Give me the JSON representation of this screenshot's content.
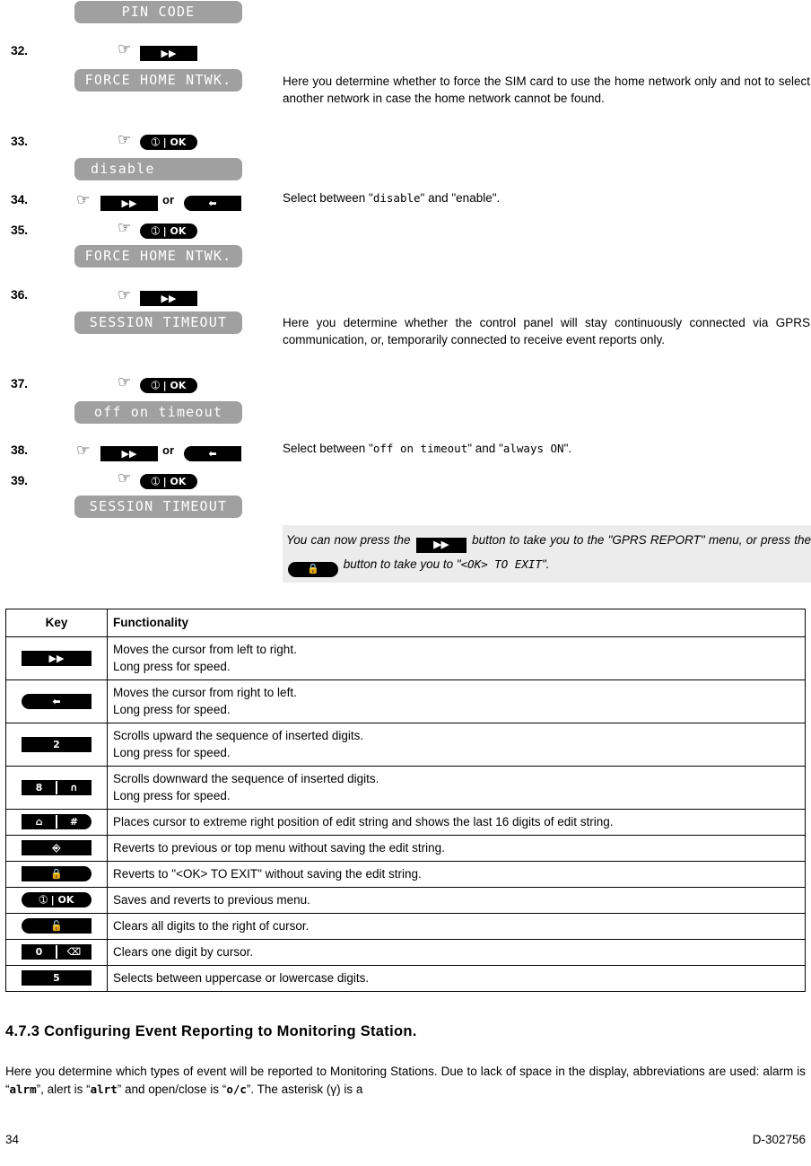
{
  "steps": {
    "top_display": "PIN CODE",
    "items": [
      {
        "num": "32.",
        "key": "next-key",
        "display": "FORCE HOME NTWK."
      },
      {
        "num": "33.",
        "key": "ok-key",
        "display": "disable",
        "has_cursor": true
      },
      {
        "num": "34.",
        "key": "next-key",
        "or_label": "or",
        "key2": "back-key"
      },
      {
        "num": "35.",
        "key": "ok-key",
        "display": "FORCE HOME NTWK."
      },
      {
        "num": "36.",
        "key": "next-key",
        "display": "SESSION TIMEOUT"
      },
      {
        "num": "37.",
        "key": "ok-key",
        "display": "off on timeout"
      },
      {
        "num": "38.",
        "key": "next-key",
        "or_label": "or",
        "key2": "back-key"
      },
      {
        "num": "39.",
        "key": "ok-key",
        "display": "SESSION TIMEOUT"
      }
    ]
  },
  "descriptions": {
    "force_home_ntwk": "Here you determine whether to force the SIM card to use the home network only and not to select another network in case the home network cannot be found.",
    "select_disable_enable_pre": "Select between \"",
    "select_disable_enable_opt1": "disable",
    "select_disable_enable_mid": "\" and \"",
    "select_disable_enable_opt2": "enable",
    "select_disable_enable_post": "\".",
    "session_timeout": "Here you determine whether the control panel will stay continuously connected via GPRS communication, or, temporarily connected to receive event reports only.",
    "select_timeout_pre": "Select between \"",
    "select_timeout_opt1": "off on timeout",
    "select_timeout_mid": "\" and \"",
    "select_timeout_opt2": "always ON",
    "select_timeout_post": "\"."
  },
  "note": {
    "part1": "You can now press the",
    "part2": "button to take you to the \"GPRS REPORT\" menu",
    "part3": ", or press the",
    "part4": "button to take you to \"",
    "part5": "<OK> TO EXIT",
    "part6": "\"."
  },
  "key_table": {
    "headers": [
      "Key",
      "Functionality"
    ],
    "rows": [
      {
        "key": "next-key",
        "icon": "fast-forward-icon",
        "lines": [
          "Moves the cursor from left to right.",
          "Long press for speed."
        ]
      },
      {
        "key": "back-key",
        "icon": "back-arrow-icon",
        "lines": [
          "Moves the cursor from right to left.",
          "Long press for speed."
        ]
      },
      {
        "key": "digit-2-key",
        "icon": "digit-2",
        "lines": [
          "Scrolls upward the sequence of inserted digits.",
          "Long press for speed."
        ]
      },
      {
        "key": "digit-8-key",
        "icon": "digit-8-bell",
        "lines": [
          "Scrolls downward the sequence of inserted digits.",
          "Long press for speed."
        ]
      },
      {
        "key": "home-hash-key",
        "icon": "home-hash",
        "lines": [
          "Places cursor to extreme right position of edit string and shows the last 16 digits of edit string."
        ]
      },
      {
        "key": "away-key",
        "icon": "away-arm-icon",
        "lines": [
          "Reverts to previous or top menu without saving the edit string."
        ]
      },
      {
        "key": "lock-key",
        "icon": "padlock-icon",
        "lines": [
          "Reverts to \"<OK> TO EXIT\" without saving the edit string."
        ]
      },
      {
        "key": "ok-key",
        "icon": "info-ok-icon",
        "lines": [
          "Saves and reverts to previous menu."
        ]
      },
      {
        "key": "disarm-key",
        "icon": "open-padlock-icon",
        "lines": [
          "Clears all digits to the right of cursor."
        ]
      },
      {
        "key": "digit-0-key",
        "icon": "digit-0-erase",
        "lines": [
          "Clears one digit by cursor."
        ]
      },
      {
        "key": "digit-5-key",
        "icon": "digit-5",
        "lines": [
          "Selects between uppercase or lowercase digits."
        ]
      }
    ]
  },
  "section": {
    "heading": "4.7.3 Configuring Event Reporting to Monitoring Station.",
    "para_1": "Here you determine which types of event will be reported to Monitoring Stations. Due to lack of space in the display, abbreviations are used: alarm is “",
    "para_alrm": "alrm",
    "para_2": "”, alert is “",
    "para_alrt": "alrt",
    "para_3": "” and open/close is “",
    "para_oc": "o/c",
    "para_4": "”. The asterisk (γ) is a"
  },
  "footer": {
    "page_number": "34",
    "doc_number": "D-302756"
  },
  "icons": {
    "hand": "☞",
    "fast_forward": "▶▶",
    "back_arrow": "↰",
    "bell": "∩",
    "hash": "#",
    "digit_2": "2",
    "digit_8": "8",
    "digit_0": "0",
    "digit_5": "5",
    "info": "ℹ",
    "ok": "OK",
    "pipe": "|"
  }
}
